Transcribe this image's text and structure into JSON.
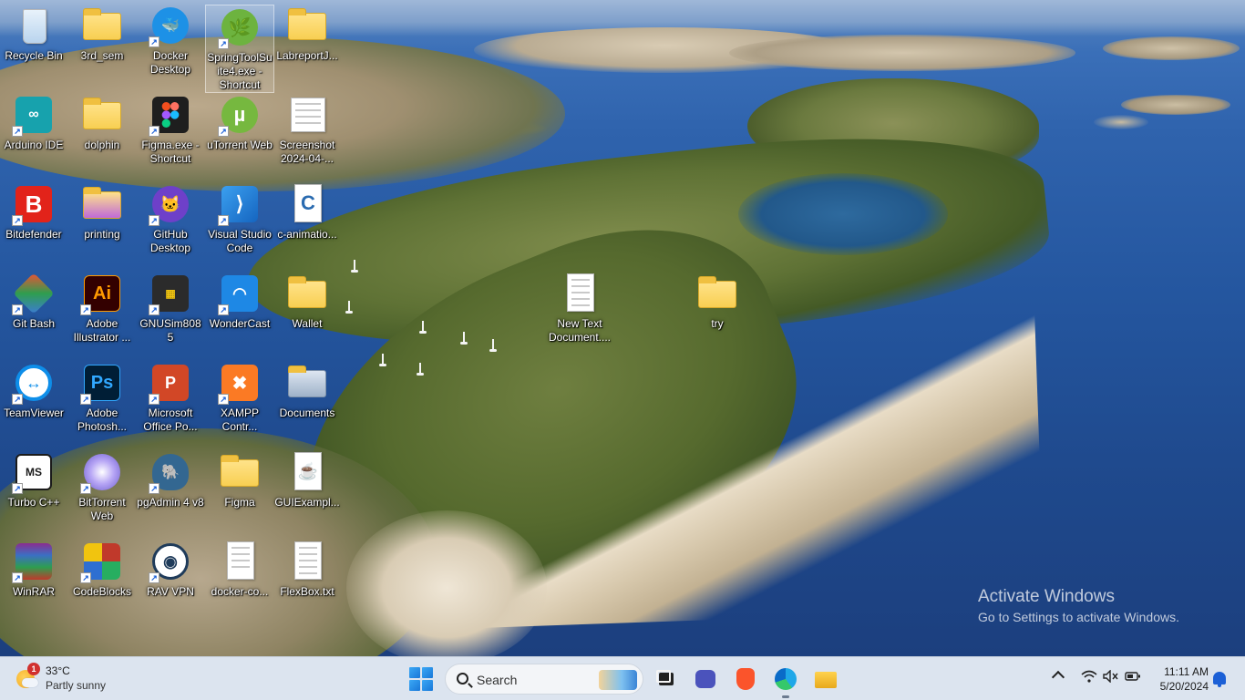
{
  "desktop": {
    "icons": [
      {
        "label": "Recycle Bin",
        "icon": "recycle-bin-icon",
        "color": "#3a8ee6"
      },
      {
        "label": "3rd_sem",
        "icon": "folder-icon",
        "color": "#f8cf52"
      },
      {
        "label": "Docker Desktop",
        "icon": "docker-icon",
        "color": "#1d91e6"
      },
      {
        "label": "SpringToolSuite4.exe - Shortcut",
        "icon": "spring-icon",
        "color": "#6db33f"
      },
      {
        "label": "LabreportJ...",
        "icon": "folder-icon",
        "color": "#f8cf52"
      },
      {
        "label": "Arduino IDE",
        "icon": "arduino-icon",
        "color": "#17a2ad"
      },
      {
        "label": "dolphin",
        "icon": "folder-icon",
        "color": "#f8cf52"
      },
      {
        "label": "Figma.exe - Shortcut",
        "icon": "figma-icon",
        "color": "#1e1e1e"
      },
      {
        "label": "uTorrent Web",
        "icon": "utorrent-icon",
        "color": "#76b83f"
      },
      {
        "label": "Screenshot 2024-04-...",
        "icon": "image-file-icon",
        "color": "#ffffff"
      },
      {
        "label": "Bitdefender",
        "icon": "bitdefender-icon",
        "color": "#e2231a"
      },
      {
        "label": "printing",
        "icon": "folder-icon",
        "color": "#f8cf52"
      },
      {
        "label": "GitHub Desktop",
        "icon": "github-icon",
        "color": "#6e40c9"
      },
      {
        "label": "Visual Studio Code",
        "icon": "vscode-icon",
        "color": "#1e88e5"
      },
      {
        "label": "c-animatio...",
        "icon": "c-file-icon",
        "color": "#2a6bb0"
      },
      {
        "label": "Git Bash",
        "icon": "git-bash-icon",
        "color": "#f05133"
      },
      {
        "label": "Adobe Illustrator ...",
        "icon": "illustrator-icon",
        "color": "#ff9a00"
      },
      {
        "label": "GNUSim8085",
        "icon": "gnusim-icon",
        "color": "#2b2b2b"
      },
      {
        "label": "WonderCast",
        "icon": "wondercast-icon",
        "color": "#1e88e5"
      },
      {
        "label": "Wallet",
        "icon": "folder-icon",
        "color": "#f8cf52"
      },
      {
        "label": "TeamViewer",
        "icon": "teamviewer-icon",
        "color": "#0e8ee9"
      },
      {
        "label": "Adobe Photosh...",
        "icon": "photoshop-icon",
        "color": "#31a8ff"
      },
      {
        "label": "Microsoft Office Po...",
        "icon": "powerpoint-icon",
        "color": "#d24726"
      },
      {
        "label": "XAMPP Contr...",
        "icon": "xampp-icon",
        "color": "#fb7a24"
      },
      {
        "label": "Documents",
        "icon": "documents-folder-icon",
        "color": "#b9c7d8"
      },
      {
        "label": "Turbo C++",
        "icon": "turbo-cpp-icon",
        "color": "#1b1b1b"
      },
      {
        "label": "BitTorrent Web",
        "icon": "bittorrent-icon",
        "color": "#6a5acd"
      },
      {
        "label": "pgAdmin 4 v8",
        "icon": "pgadmin-icon",
        "color": "#336791"
      },
      {
        "label": "Figma",
        "icon": "folder-icon",
        "color": "#f8cf52"
      },
      {
        "label": "GUIExampl...",
        "icon": "java-file-icon",
        "color": "#e76f00"
      },
      {
        "label": "WinRAR",
        "icon": "winrar-icon",
        "color": "#8b2d8f"
      },
      {
        "label": "CodeBlocks",
        "icon": "codeblocks-icon",
        "color": "#c0392b"
      },
      {
        "label": "RAV VPN",
        "icon": "rav-vpn-icon",
        "color": "#1f3b5a"
      },
      {
        "label": "docker-co...",
        "icon": "vscode-file-icon",
        "color": "#1e88e5"
      },
      {
        "label": "FlexBox.txt",
        "icon": "text-file-icon",
        "color": "#ffffff"
      },
      {
        "label": "New Text Document....",
        "icon": "text-file-icon",
        "color": "#ffffff"
      },
      {
        "label": "try",
        "icon": "folder-icon",
        "color": "#f8cf52"
      }
    ]
  },
  "watermark": {
    "title": "Activate Windows",
    "subtitle": "Go to Settings to activate Windows."
  },
  "taskbar": {
    "weather": {
      "badge": "1",
      "temp": "33°C",
      "condition": "Partly sunny"
    },
    "search_placeholder": "Search",
    "clock": {
      "time": "11:11 AM",
      "date": "5/20/2024"
    }
  }
}
